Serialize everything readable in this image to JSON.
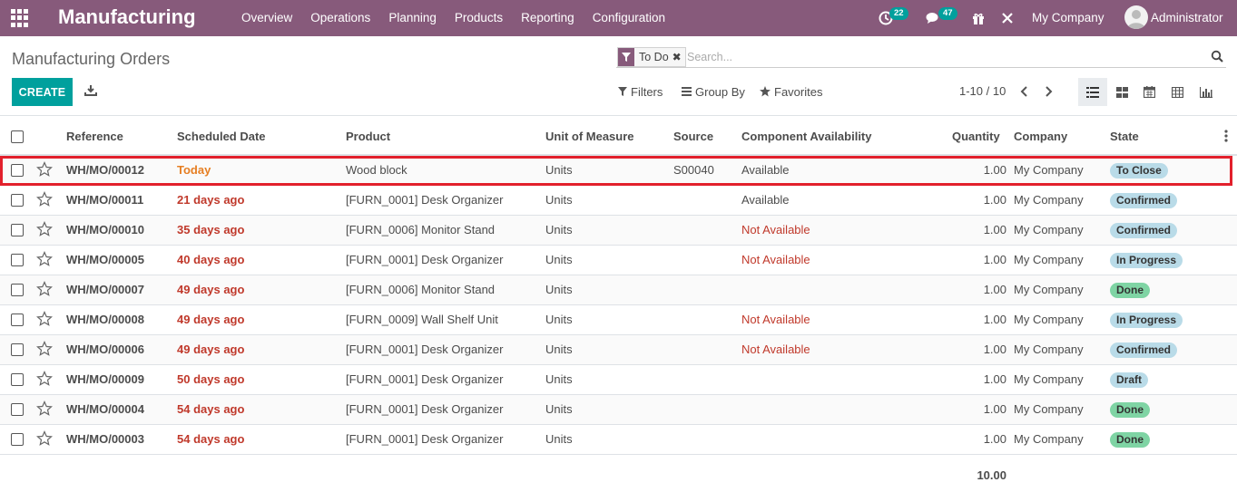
{
  "navbar": {
    "app_title": "Manufacturing",
    "menu": [
      "Overview",
      "Operations",
      "Planning",
      "Products",
      "Reporting",
      "Configuration"
    ],
    "activity_count": "22",
    "messages_count": "47",
    "company": "My Company",
    "user": "Administrator",
    "bg_color": "#875a7b"
  },
  "control_panel": {
    "breadcrumb": "Manufacturing Orders",
    "facet_label": "To Do",
    "search_placeholder": "Search...",
    "create_label": "CREATE",
    "filters_label": "Filters",
    "group_by_label": "Group By",
    "favorites_label": "Favorites",
    "pager": "1-10 / 10",
    "accent_color": "#00a09d"
  },
  "table": {
    "headers": [
      "Reference",
      "Scheduled Date",
      "Product",
      "Unit of Measure",
      "Source",
      "Component Availability",
      "Quantity",
      "Company",
      "State"
    ],
    "rows": [
      {
        "ref": "WH/MO/00012",
        "date": "Today",
        "product": "Wood block",
        "uom": "Units",
        "source": "S00040",
        "avail": "Available",
        "qty": "1.00",
        "company": "My Company",
        "state": "To Close"
      },
      {
        "ref": "WH/MO/00011",
        "date": "21 days ago",
        "product": "[FURN_0001] Desk Organizer",
        "uom": "Units",
        "source": "",
        "avail": "Available",
        "qty": "1.00",
        "company": "My Company",
        "state": "Confirmed"
      },
      {
        "ref": "WH/MO/00010",
        "date": "35 days ago",
        "product": "[FURN_0006] Monitor Stand",
        "uom": "Units",
        "source": "",
        "avail": "Not Available",
        "qty": "1.00",
        "company": "My Company",
        "state": "Confirmed"
      },
      {
        "ref": "WH/MO/00005",
        "date": "40 days ago",
        "product": "[FURN_0001] Desk Organizer",
        "uom": "Units",
        "source": "",
        "avail": "Not Available",
        "qty": "1.00",
        "company": "My Company",
        "state": "In Progress"
      },
      {
        "ref": "WH/MO/00007",
        "date": "49 days ago",
        "product": "[FURN_0006] Monitor Stand",
        "uom": "Units",
        "source": "",
        "avail": "",
        "qty": "1.00",
        "company": "My Company",
        "state": "Done"
      },
      {
        "ref": "WH/MO/00008",
        "date": "49 days ago",
        "product": "[FURN_0009] Wall Shelf Unit",
        "uom": "Units",
        "source": "",
        "avail": "Not Available",
        "qty": "1.00",
        "company": "My Company",
        "state": "In Progress"
      },
      {
        "ref": "WH/MO/00006",
        "date": "49 days ago",
        "product": "[FURN_0001] Desk Organizer",
        "uom": "Units",
        "source": "",
        "avail": "Not Available",
        "qty": "1.00",
        "company": "My Company",
        "state": "Confirmed"
      },
      {
        "ref": "WH/MO/00009",
        "date": "50 days ago",
        "product": "[FURN_0001] Desk Organizer",
        "uom": "Units",
        "source": "",
        "avail": "",
        "qty": "1.00",
        "company": "My Company",
        "state": "Draft"
      },
      {
        "ref": "WH/MO/00004",
        "date": "54 days ago",
        "product": "[FURN_0001] Desk Organizer",
        "uom": "Units",
        "source": "",
        "avail": "",
        "qty": "1.00",
        "company": "My Company",
        "state": "Done"
      },
      {
        "ref": "WH/MO/00003",
        "date": "54 days ago",
        "product": "[FURN_0001] Desk Organizer",
        "uom": "Units",
        "source": "",
        "avail": "",
        "qty": "1.00",
        "company": "My Company",
        "state": "Done"
      }
    ],
    "total_quantity": "10.00",
    "state_colors": {
      "To Close": "#b9dbe8",
      "Confirmed": "#b9dbe8",
      "In Progress": "#b9dbe8",
      "Done": "#7fd4a4",
      "Draft": "#b9dbe8"
    },
    "overdue_color": "#c0392b",
    "today_color": "#e67e22"
  }
}
